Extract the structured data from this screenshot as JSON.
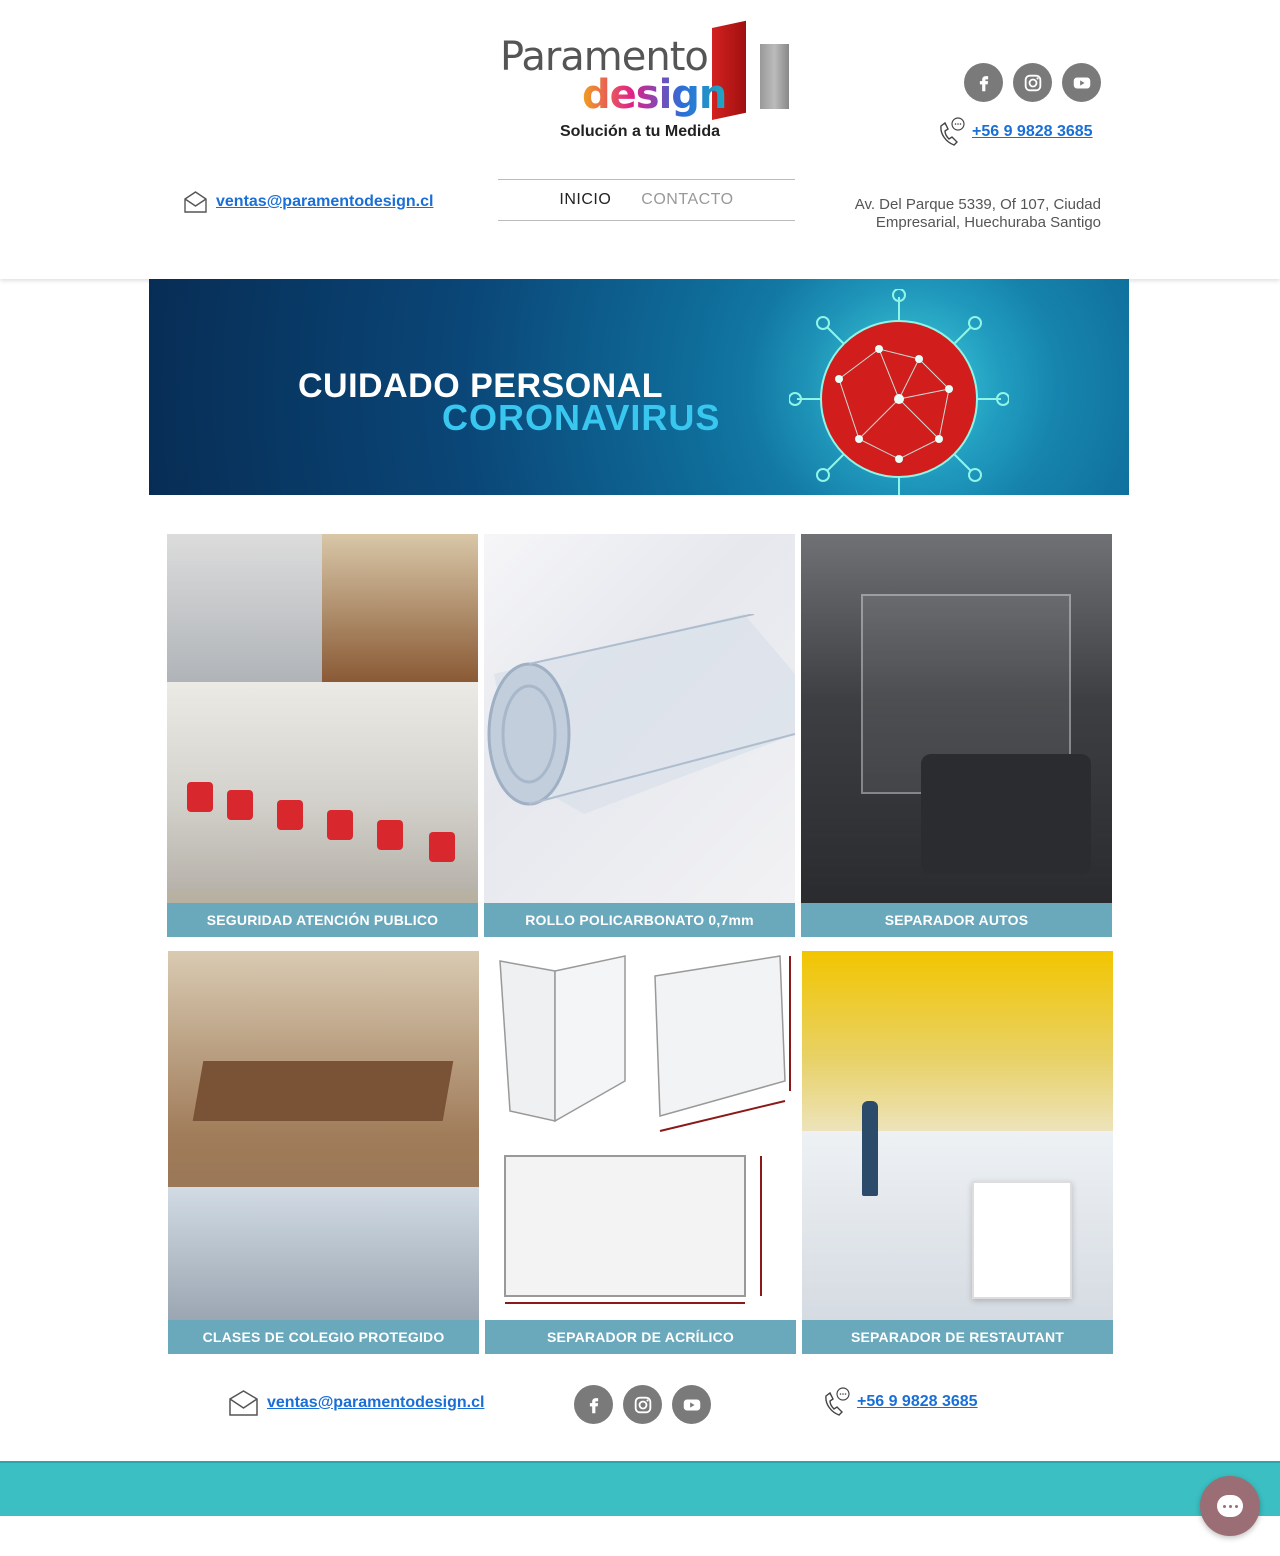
{
  "brand": {
    "logo_line1": "Paramento",
    "logo_line2": "design",
    "tagline": "Solución a tu Medida"
  },
  "contact": {
    "email": "ventas@paramentodesign.cl",
    "phone": "+56 9 9828 3685",
    "address_line1": "Av. Del Parque 5339, Of 107, Ciudad",
    "address_line2": "Empresarial, Huechuraba  Santigo"
  },
  "nav": {
    "items": [
      {
        "label": "INICIO",
        "active": true
      },
      {
        "label": "CONTACTO",
        "active": false
      }
    ]
  },
  "social": [
    "facebook-icon",
    "instagram-icon",
    "youtube-icon"
  ],
  "banner": {
    "title": "CUIDADO PERSONAL",
    "subtitle": "CORONAVIRUS"
  },
  "products": [
    {
      "label": "SEGURIDAD ATENCIÓN PUBLICO"
    },
    {
      "label": "ROLLO POLICARBONATO 0,7mm"
    },
    {
      "label": "SEPARADOR AUTOS"
    },
    {
      "label": "CLASES DE COLEGIO PROTEGIDO"
    },
    {
      "label": "SEPARADOR DE ACRÍLICO"
    },
    {
      "label": "SEPARADOR DE RESTAUTANT"
    }
  ],
  "colors": {
    "link": "#1a6fd6",
    "label_bg": "#6aa8bc",
    "footer_band": "#3bbfc2",
    "chat_button": "#9b6d74",
    "social_icon_bg": "#7a7a7a"
  }
}
